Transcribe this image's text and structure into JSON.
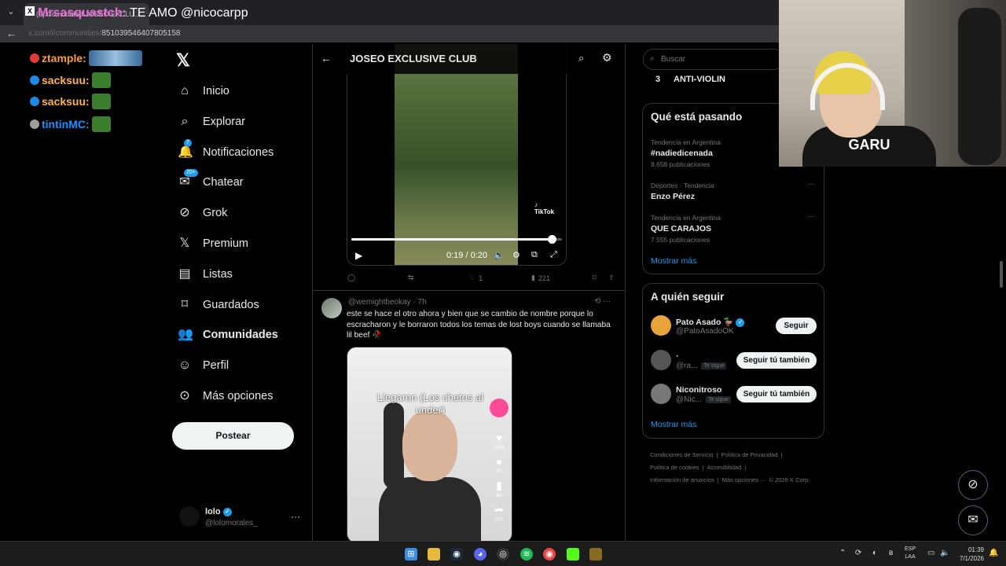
{
  "browser": {
    "tab_title": "(3) Comunidad JOSEO EXCLU...",
    "tab_favicon": "X",
    "url_fragment": "851039546407805158",
    "back_icon": "back-arrow-icon"
  },
  "stream_overlay": {
    "title_user": "Mrsasquastch:",
    "title_msg": "TE AMO @nicocarpp",
    "chat": [
      {
        "user": "ztample:",
        "color": "#ff9a3c"
      },
      {
        "user": "sacksuu:",
        "color": "#ffb347"
      },
      {
        "user": "sacksuu:",
        "color": "#ffb347"
      },
      {
        "user": "tintinMC:",
        "color": "#1e90ff"
      }
    ]
  },
  "nav": {
    "items": [
      {
        "label": "Inicio",
        "icon": "home-icon"
      },
      {
        "label": "Explorar",
        "icon": "search-icon"
      },
      {
        "label": "Notificaciones",
        "icon": "bell-icon",
        "badge": "7"
      },
      {
        "label": "Chatear",
        "icon": "mail-icon",
        "badge": "20+"
      },
      {
        "label": "Grok",
        "icon": "grok-icon"
      },
      {
        "label": "Premium",
        "icon": "x-icon"
      },
      {
        "label": "Listas",
        "icon": "list-icon"
      },
      {
        "label": "Guardados",
        "icon": "bookmark-icon"
      },
      {
        "label": "Comunidades",
        "icon": "communities-icon"
      },
      {
        "label": "Perfil",
        "icon": "person-icon"
      },
      {
        "label": "Más opciones",
        "icon": "more-icon"
      }
    ],
    "post_label": "Postear",
    "account": {
      "name": "lolo",
      "handle": "@lolomorales_"
    }
  },
  "center": {
    "header_title": "JOSEO EXCLUSIVE CLUB",
    "video1": {
      "watermark": "TikTok",
      "time": "0:19 / 0:20",
      "progress": 0.95
    },
    "tweet1_actions": {
      "likes": "1",
      "views": "221"
    },
    "tweet2": {
      "handle": "@wemightbeokay",
      "age": "· 7h",
      "text": "este se hace el otro ahora y bien que se cambio de nombre porque lo escracharon y le borraron todos los temas de lost boys cuando se llamaba lil beef 🥀",
      "video_caption": "Llegaron (Los chetos al under)",
      "side_counts": [
        "4,665",
        "93",
        "94",
        "277"
      ]
    }
  },
  "right": {
    "search_placeholder": "Buscar",
    "top_item": {
      "rank": "3",
      "name": "ANTI-VIOLIN"
    },
    "trends_title": "Qué está pasando",
    "trends": [
      {
        "context": "Tendencia en Argentina",
        "name": "#nadiedicenada",
        "count": "8.658 publicaciones"
      },
      {
        "context": "Deportes · Tendencia",
        "name": "Enzo Pérez",
        "count": ""
      },
      {
        "context": "Tendencia en Argentina",
        "name": "QUE CARAJOS",
        "count": "7.555 publicaciones"
      }
    ],
    "show_more": "Mostrar más",
    "who_title": "A quién seguir",
    "who": [
      {
        "name": "Pato Asado 🦆",
        "handle": "@PatoAsadoOK",
        "button": "Seguir",
        "follows_you": ""
      },
      {
        "name": "·",
        "handle": "@ra...",
        "button": "Seguir tú también",
        "follows_you": "Te sigue"
      },
      {
        "name": "Niconitroso",
        "handle": "@Nic...",
        "button": "Seguir tú también",
        "follows_you": "Te sigue"
      }
    ],
    "footer": [
      "Condiciones de Servicio",
      "|",
      "Política de Privacidad",
      "|",
      "Política de cookies",
      "|",
      "Accesibilidad",
      "|",
      "Información de anuncios",
      "|",
      "Más opciones ···",
      "© 2026 X Corp."
    ]
  },
  "taskbar": {
    "lang_top": "ESP",
    "lang_bottom": "LAA",
    "time": "01:39",
    "date": "7/1/2026"
  }
}
